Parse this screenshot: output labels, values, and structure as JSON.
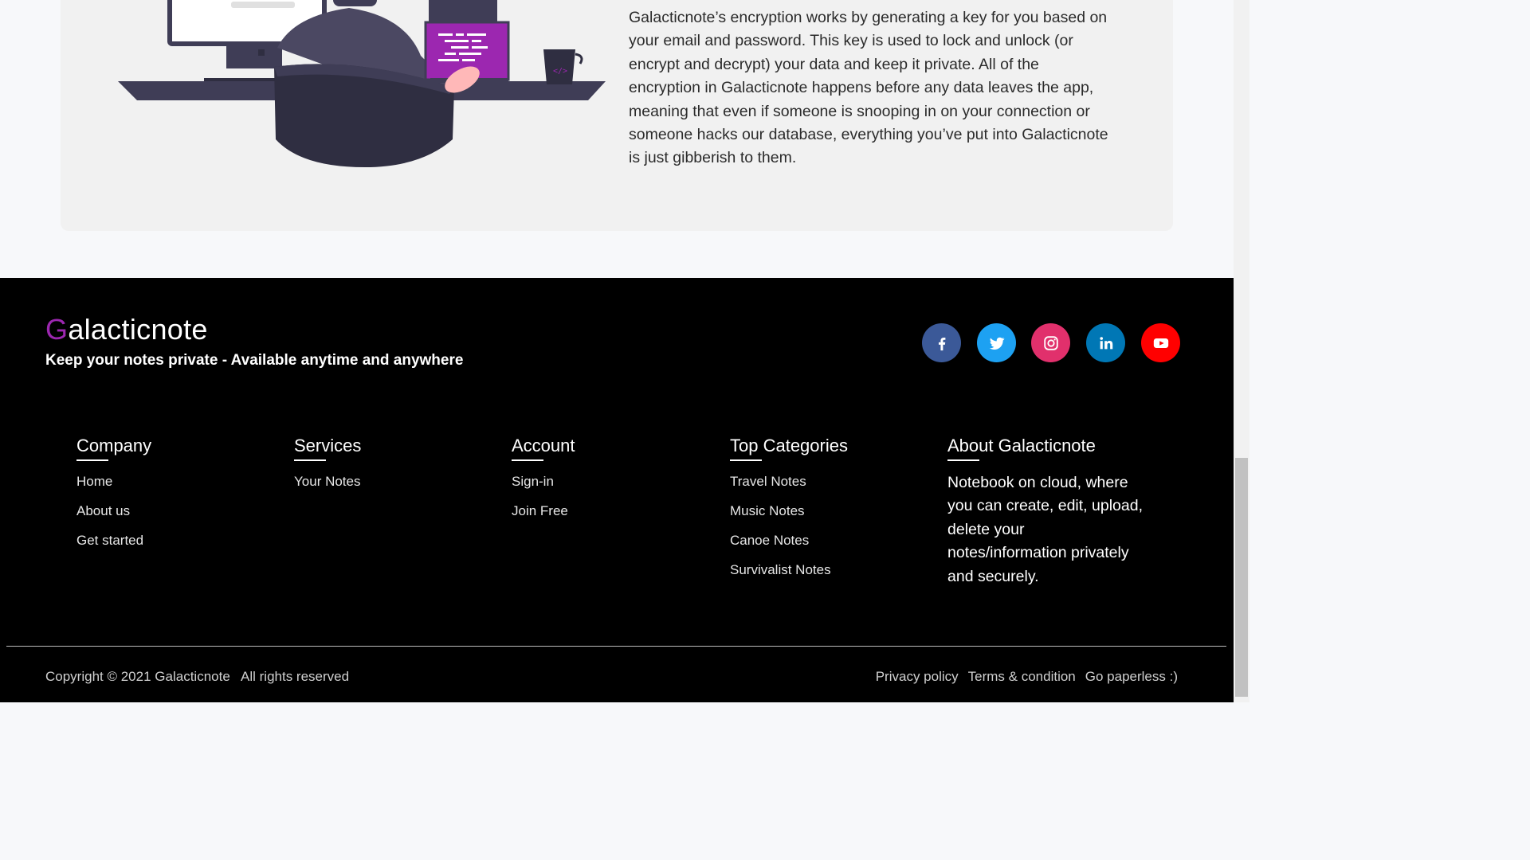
{
  "info": {
    "paragraph": "Galacticnote’s encryption works by generating a key for you based on your email and password. This key is used to lock and unlock (or encrypt and decrypt) your data and keep it private. All of the encryption in Galacticnote happens before any data leaves the app, meaning that even if someone is snooping in on your connection or someone hacks our database, everything you’ve put into Galacticnote is just gibberish to them."
  },
  "footer": {
    "brand_initial": "G",
    "brand_rest": "alacticnote",
    "tagline": "Keep your notes private - Available anytime and anywhere",
    "social": [
      {
        "icon": "facebook-icon",
        "color": "#3b5998"
      },
      {
        "icon": "twitter-icon",
        "color": "#1da1f2"
      },
      {
        "icon": "instagram-icon",
        "color": "#e1306c"
      },
      {
        "icon": "linkedin-icon",
        "color": "#0077b5"
      },
      {
        "icon": "youtube-icon",
        "color": "#ff0000"
      }
    ],
    "columns": {
      "company": {
        "title": "Company",
        "links": [
          "Home",
          "About us",
          "Get started"
        ]
      },
      "services": {
        "title": "Services",
        "links": [
          "Your Notes"
        ]
      },
      "account": {
        "title": "Account",
        "links": [
          "Sign-in",
          "Join Free"
        ]
      },
      "categories": {
        "title": "Top Categories",
        "links": [
          "Travel Notes",
          "Music Notes",
          "Canoe Notes",
          "Survivalist Notes"
        ]
      },
      "about": {
        "title": "About Galacticnote",
        "text": "Notebook on cloud, where you can create, edit, upload, delete your notes/information privately and securely."
      }
    },
    "copyright_prefix": "Copyright © 2021",
    "copyright_brand": "Galacticnote",
    "copyright_suffix": "All rights reserved",
    "bottom_links": [
      "Privacy policy",
      "Terms & condition",
      "Go paperless :)"
    ]
  },
  "colors": {
    "brand_accent": "#9c27b0",
    "footer_bg": "#000000",
    "card_bg": "#f1f1f1"
  }
}
